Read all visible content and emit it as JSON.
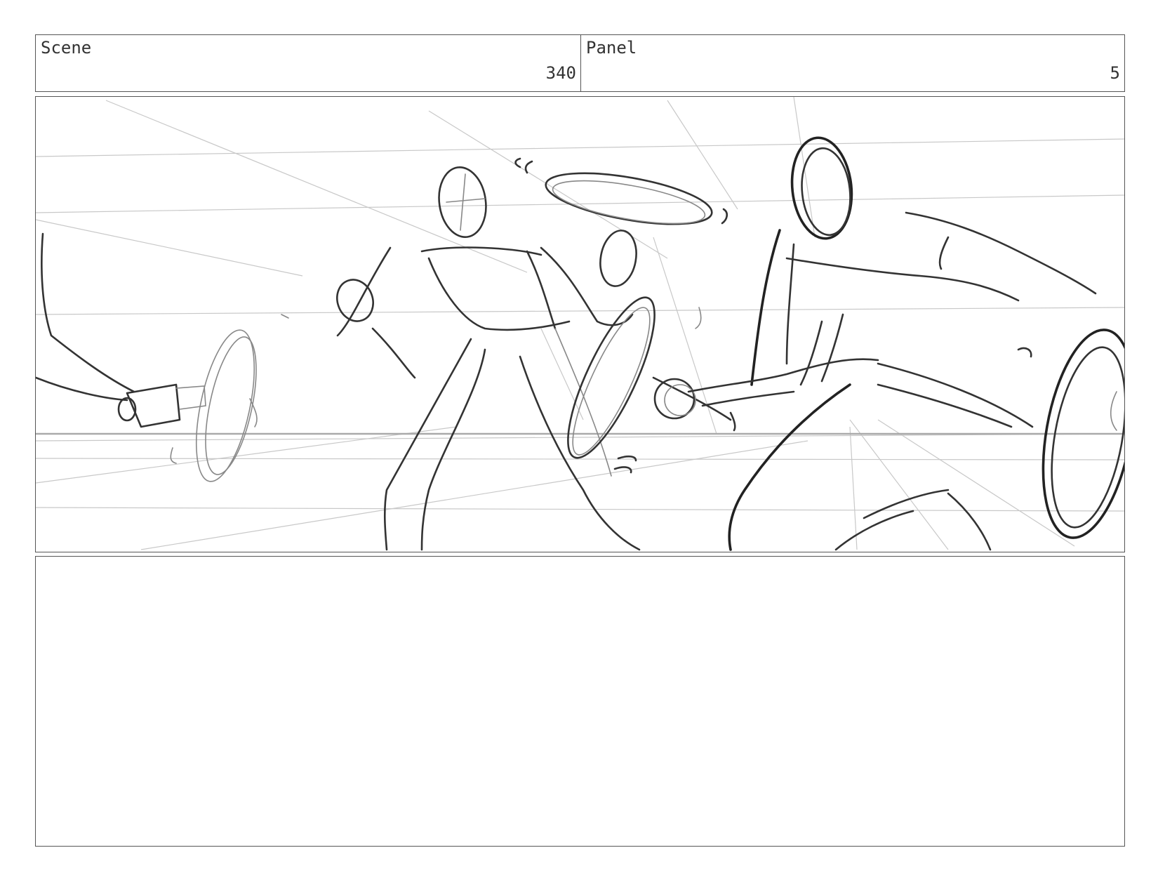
{
  "header": {
    "scene_label": "Scene",
    "scene_value": "340",
    "panel_label": "Panel",
    "panel_value": "5"
  },
  "frame": {
    "content": "sketch-illustration"
  },
  "notes": {
    "text": ""
  }
}
